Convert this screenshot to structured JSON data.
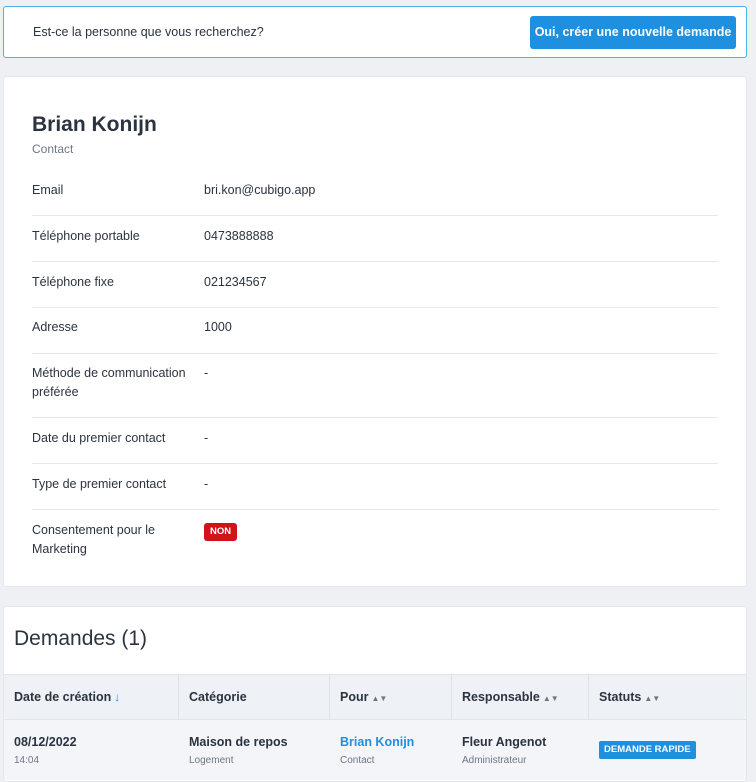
{
  "banner": {
    "question": "Est-ce la personne que vous recherchez?",
    "button_label": "Oui, créer une nouvelle demande"
  },
  "contact": {
    "name": "Brian Konijn",
    "type": "Contact",
    "fields": [
      {
        "label": "Email",
        "value": "bri.kon@cubigo.app"
      },
      {
        "label": "Téléphone portable",
        "value": "0473888888"
      },
      {
        "label": "Téléphone fixe",
        "value": "021234567"
      },
      {
        "label": "Adresse",
        "value": "1000"
      },
      {
        "label": "Méthode de communication préférée",
        "value": "-"
      },
      {
        "label": "Date du premier contact",
        "value": "-"
      },
      {
        "label": "Type de premier contact",
        "value": "-"
      },
      {
        "label": "Consentement pour le Marketing",
        "value": "NON"
      }
    ]
  },
  "requests": {
    "title": "Demandes (1)",
    "columns": [
      {
        "label": "Date de création",
        "sort": "↓"
      },
      {
        "label": "Catégorie",
        "sort": ""
      },
      {
        "label": "Pour",
        "sort": "▲▼"
      },
      {
        "label": "Responsable",
        "sort": "▲▼"
      },
      {
        "label": "Statuts",
        "sort": "▲▼"
      }
    ],
    "rows": [
      {
        "date": "08/12/2022",
        "time": "14:04",
        "category": "Maison de repos",
        "category_sub": "Logement",
        "for_name": "Brian Konijn",
        "for_sub": "Contact",
        "owner": "Fleur Angenot",
        "owner_sub": "Administrateur",
        "status": "DEMANDE RAPIDE"
      }
    ]
  },
  "colors": {
    "accent": "#1f8fe0",
    "danger": "#d1111c",
    "banner_border": "#45b3e6"
  }
}
